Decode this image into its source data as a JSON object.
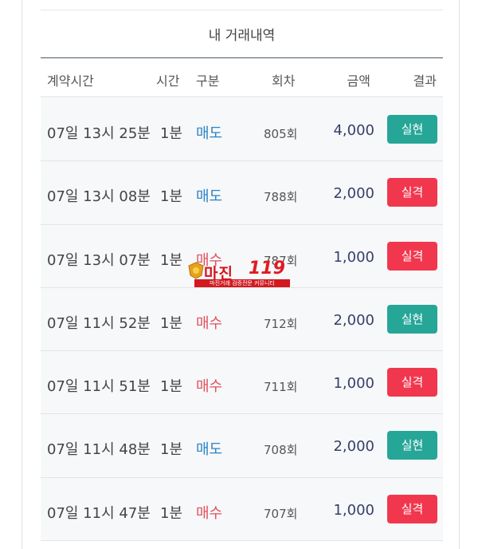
{
  "panel": {
    "title": "내 거래내역"
  },
  "columns": {
    "time": "계약시간",
    "duration": "시간",
    "type": "구분",
    "round": "회차",
    "amount": "금액",
    "result": "결과"
  },
  "rows": [
    {
      "time": "07일 13시 25분",
      "duration": "1분",
      "type": "매도",
      "round": "805회",
      "amount": "4,000",
      "result": "실현"
    },
    {
      "time": "07일 13시 08분",
      "duration": "1분",
      "type": "매도",
      "round": "788회",
      "amount": "2,000",
      "result": "실격"
    },
    {
      "time": "07일 13시 07분",
      "duration": "1분",
      "type": "매수",
      "round": "787회",
      "amount": "1,000",
      "result": "실격"
    },
    {
      "time": "07일 11시 52분",
      "duration": "1분",
      "type": "매수",
      "round": "712회",
      "amount": "2,000",
      "result": "실현"
    },
    {
      "time": "07일 11시 51분",
      "duration": "1분",
      "type": "매수",
      "round": "711회",
      "amount": "1,000",
      "result": "실격"
    },
    {
      "time": "07일 11시 48분",
      "duration": "1분",
      "type": "매도",
      "round": "708회",
      "amount": "2,000",
      "result": "실현"
    },
    {
      "time": "07일 11시 47분",
      "duration": "1분",
      "type": "매수",
      "round": "707회",
      "amount": "1,000",
      "result": "실격"
    }
  ],
  "watermark": {
    "name": "마진",
    "number": "119",
    "tagline": "마진거래 검증전문 커뮤니티"
  },
  "colors": {
    "sell": "#2b83c6",
    "buy": "#e0505e",
    "win": "#26a697",
    "lose": "#f1374e",
    "amount": "#35406a"
  }
}
